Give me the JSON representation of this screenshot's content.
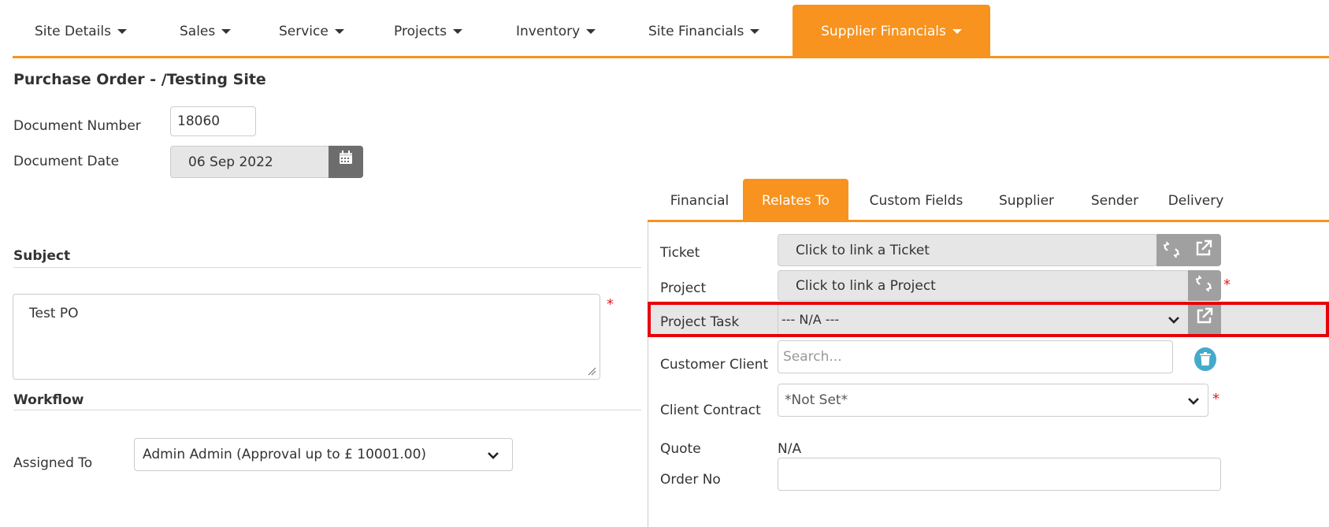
{
  "nav": {
    "items": [
      {
        "label": "Site Details"
      },
      {
        "label": "Sales"
      },
      {
        "label": "Service"
      },
      {
        "label": "Projects"
      },
      {
        "label": "Inventory"
      },
      {
        "label": "Site Financials"
      },
      {
        "label": "Supplier Financials",
        "active": true
      }
    ]
  },
  "page_title": "Purchase Order - /Testing Site",
  "document": {
    "number_label": "Document Number",
    "number_value": "18060",
    "date_label": "Document Date",
    "date_value": "06 Sep 2022"
  },
  "subject": {
    "heading": "Subject",
    "value": "Test PO",
    "required_mark": "*"
  },
  "workflow": {
    "heading": "Workflow",
    "assigned_label": "Assigned To",
    "assigned_value": "Admin Admin (Approval up to £ 10001.00)"
  },
  "tabs": [
    {
      "label": "Financial"
    },
    {
      "label": "Relates To",
      "active": true
    },
    {
      "label": "Custom Fields"
    },
    {
      "label": "Supplier"
    },
    {
      "label": "Sender"
    },
    {
      "label": "Delivery"
    }
  ],
  "relates": {
    "ticket_label": "Ticket",
    "ticket_placeholder": "Click to link a Ticket",
    "project_label": "Project",
    "project_placeholder": "Click to link a Project",
    "project_required": "*",
    "project_task_label": "Project Task",
    "project_task_value": "--- N/A ---",
    "customer_client_label": "Customer Client",
    "customer_client_placeholder": "Search...",
    "client_contract_label": "Client Contract",
    "client_contract_value": "*Not Set*",
    "client_contract_required": "*",
    "quote_label": "Quote",
    "quote_value": "N/A",
    "order_no_label": "Order No",
    "order_no_value": ""
  },
  "colors": {
    "accent": "#f7931e",
    "highlight": "#e8000b",
    "required": "#e02020",
    "icon_button": "#a0a0a0",
    "trash": "#44aacc"
  },
  "icons": [
    "caret-down-icon",
    "calendar-icon",
    "unlink-icon",
    "external-link-icon",
    "chevron-down-icon",
    "trash-icon",
    "resize-handle-icon"
  ]
}
